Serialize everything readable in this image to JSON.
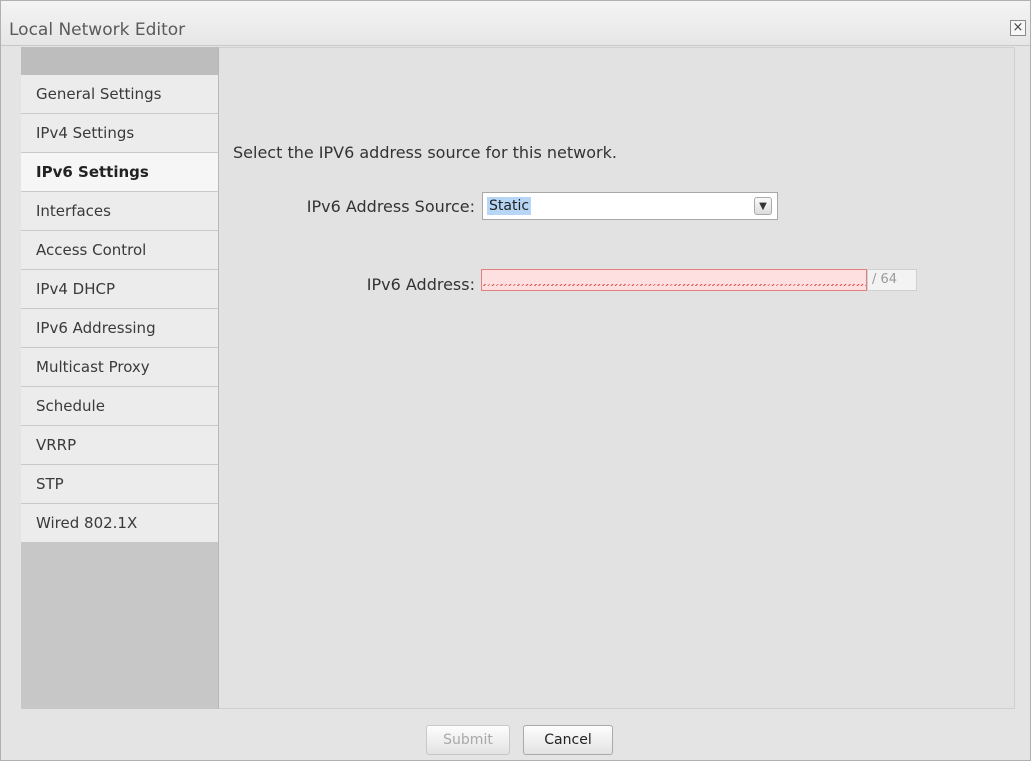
{
  "window": {
    "title": "Local Network Editor",
    "close_symbol": "×"
  },
  "sidebar": {
    "items": [
      {
        "label": "General Settings"
      },
      {
        "label": "IPv4 Settings"
      },
      {
        "label": "IPv6 Settings",
        "active": true
      },
      {
        "label": "Interfaces"
      },
      {
        "label": "Access Control"
      },
      {
        "label": "IPv4 DHCP"
      },
      {
        "label": "IPv6 Addressing"
      },
      {
        "label": "Multicast Proxy"
      },
      {
        "label": "Schedule"
      },
      {
        "label": "VRRP"
      },
      {
        "label": "STP"
      },
      {
        "label": "Wired 802.1X"
      }
    ]
  },
  "main": {
    "description": "Select the IPV6 address source for this network.",
    "address_source": {
      "label": "IPv6 Address Source:",
      "selected": "Static"
    },
    "address": {
      "label": "IPv6 Address:",
      "value": "",
      "prefix": "64",
      "prefix_separator": "/"
    }
  },
  "footer": {
    "submit_label": "Submit",
    "cancel_label": "Cancel"
  },
  "colors": {
    "invalid_field": "#ffe0e0",
    "selected_text_highlight": "#b7d5f5"
  }
}
